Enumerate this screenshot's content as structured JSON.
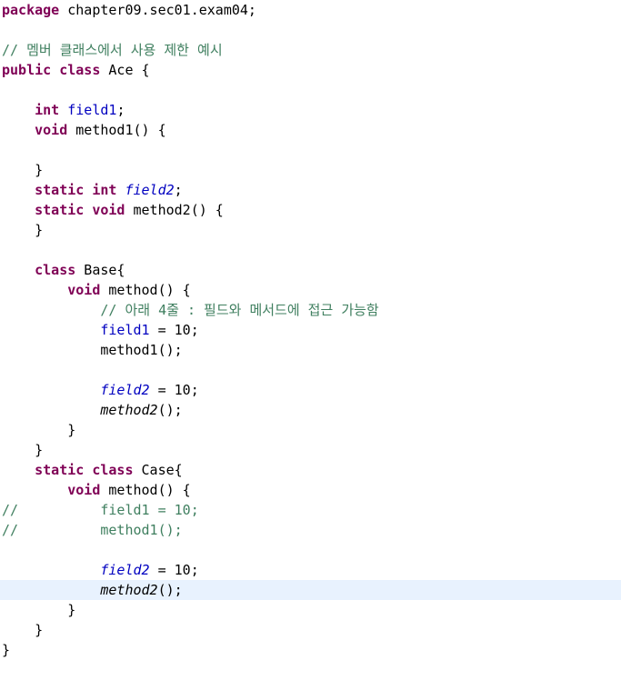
{
  "editor": {
    "lines": [
      {
        "tokens": [
          {
            "t": "package",
            "c": "kw"
          },
          {
            "t": " chapter09.sec01.exam04;",
            "c": "pl"
          }
        ]
      },
      {
        "tokens": []
      },
      {
        "tokens": [
          {
            "t": "// 멤버 클래스에서 사용 제한 예시",
            "c": "cm"
          }
        ]
      },
      {
        "tokens": [
          {
            "t": "public",
            "c": "kw"
          },
          {
            "t": " ",
            "c": "pl"
          },
          {
            "t": "class",
            "c": "kw"
          },
          {
            "t": " Ace {",
            "c": "pl"
          }
        ]
      },
      {
        "tokens": []
      },
      {
        "tokens": [
          {
            "t": "    ",
            "c": "pl"
          },
          {
            "t": "int",
            "c": "kw"
          },
          {
            "t": " ",
            "c": "pl"
          },
          {
            "t": "field1",
            "c": "fd"
          },
          {
            "t": ";",
            "c": "pl"
          }
        ]
      },
      {
        "tokens": [
          {
            "t": "    ",
            "c": "pl"
          },
          {
            "t": "void",
            "c": "kw"
          },
          {
            "t": " method1() {",
            "c": "pl"
          }
        ]
      },
      {
        "tokens": []
      },
      {
        "tokens": [
          {
            "t": "    }",
            "c": "pl"
          }
        ]
      },
      {
        "tokens": [
          {
            "t": "    ",
            "c": "pl"
          },
          {
            "t": "static",
            "c": "kw"
          },
          {
            "t": " ",
            "c": "pl"
          },
          {
            "t": "int",
            "c": "kw"
          },
          {
            "t": " ",
            "c": "pl"
          },
          {
            "t": "field2",
            "c": "st"
          },
          {
            "t": ";",
            "c": "pl"
          }
        ]
      },
      {
        "tokens": [
          {
            "t": "    ",
            "c": "pl"
          },
          {
            "t": "static",
            "c": "kw"
          },
          {
            "t": " ",
            "c": "pl"
          },
          {
            "t": "void",
            "c": "kw"
          },
          {
            "t": " method2() {",
            "c": "pl"
          }
        ]
      },
      {
        "tokens": [
          {
            "t": "    }",
            "c": "pl"
          }
        ]
      },
      {
        "tokens": []
      },
      {
        "tokens": [
          {
            "t": "    ",
            "c": "pl"
          },
          {
            "t": "class",
            "c": "kw"
          },
          {
            "t": " Base{",
            "c": "pl"
          }
        ]
      },
      {
        "tokens": [
          {
            "t": "        ",
            "c": "pl"
          },
          {
            "t": "void",
            "c": "kw"
          },
          {
            "t": " method() {",
            "c": "pl"
          }
        ]
      },
      {
        "tokens": [
          {
            "t": "            ",
            "c": "pl"
          },
          {
            "t": "// 아래 4줄 : 필드와 메서드에 접근 가능함",
            "c": "cm"
          }
        ]
      },
      {
        "tokens": [
          {
            "t": "            ",
            "c": "pl"
          },
          {
            "t": "field1",
            "c": "fd"
          },
          {
            "t": " = 10;",
            "c": "pl"
          }
        ]
      },
      {
        "tokens": [
          {
            "t": "            method1();",
            "c": "pl"
          }
        ]
      },
      {
        "tokens": []
      },
      {
        "tokens": [
          {
            "t": "            ",
            "c": "pl"
          },
          {
            "t": "field2",
            "c": "st"
          },
          {
            "t": " = 10;",
            "c": "pl"
          }
        ]
      },
      {
        "tokens": [
          {
            "t": "            ",
            "c": "pl"
          },
          {
            "t": "method2",
            "c": "sm"
          },
          {
            "t": "();",
            "c": "pl"
          }
        ]
      },
      {
        "tokens": [
          {
            "t": "        }",
            "c": "pl"
          }
        ]
      },
      {
        "tokens": [
          {
            "t": "    }",
            "c": "pl"
          }
        ]
      },
      {
        "tokens": [
          {
            "t": "    ",
            "c": "pl"
          },
          {
            "t": "static",
            "c": "kw"
          },
          {
            "t": " ",
            "c": "pl"
          },
          {
            "t": "class",
            "c": "kw"
          },
          {
            "t": " Case{",
            "c": "pl"
          }
        ]
      },
      {
        "tokens": [
          {
            "t": "        ",
            "c": "pl"
          },
          {
            "t": "void",
            "c": "kw"
          },
          {
            "t": " method() {",
            "c": "pl"
          }
        ]
      },
      {
        "tokens": [
          {
            "t": "//          field1 = 10;",
            "c": "cm"
          }
        ]
      },
      {
        "tokens": [
          {
            "t": "//          method1();",
            "c": "cm"
          }
        ]
      },
      {
        "tokens": []
      },
      {
        "tokens": [
          {
            "t": "            ",
            "c": "pl"
          },
          {
            "t": "field2",
            "c": "st"
          },
          {
            "t": " = 10;",
            "c": "pl"
          }
        ]
      },
      {
        "tokens": [
          {
            "t": "            ",
            "c": "pl"
          },
          {
            "t": "method2",
            "c": "sm"
          },
          {
            "t": "();",
            "c": "pl"
          }
        ],
        "current": true
      },
      {
        "tokens": [
          {
            "t": "        }",
            "c": "pl"
          }
        ]
      },
      {
        "tokens": [
          {
            "t": "    }",
            "c": "pl"
          }
        ]
      },
      {
        "tokens": [
          {
            "t": "}",
            "c": "pl"
          }
        ]
      }
    ]
  }
}
